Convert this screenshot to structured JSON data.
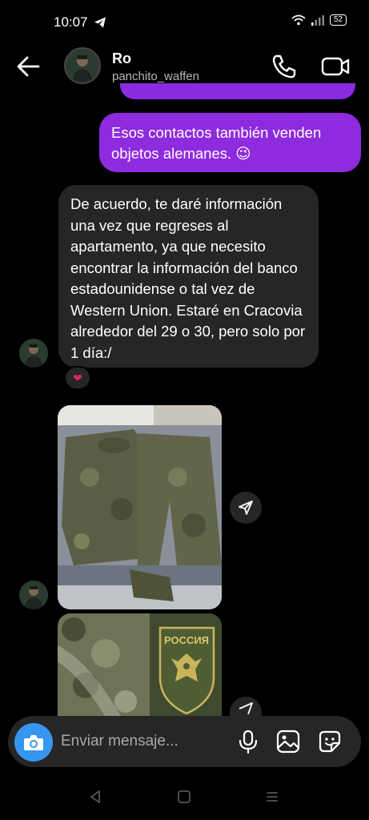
{
  "status_bar": {
    "time": "10:07",
    "battery": "52"
  },
  "header": {
    "name": "Ro",
    "username": "panchito_waffen"
  },
  "messages": [
    {
      "direction": "outgoing",
      "text": "Esos contactos también venden objetos alemanes. 😉"
    },
    {
      "direction": "incoming",
      "text": "De acuerdo, te daré información una vez que regreses al apartamento, ya que necesito encontrar la información del banco estadounidense o tal vez de Western Union. Estaré en Cracovia alrededor del 29 o 30, pero solo por 1 día:/",
      "reaction": "❤"
    },
    {
      "direction": "incoming",
      "type": "photo",
      "subject": "camouflage-uniform"
    },
    {
      "direction": "incoming",
      "type": "photo",
      "subject": "russia-patch",
      "patch_text": "РОССИЯ"
    }
  ],
  "composer": {
    "placeholder": "Enviar mensaje..."
  },
  "colors": {
    "outgoing_bubble": "#8e2bdf",
    "incoming_bubble": "#262626",
    "camera_button": "#3797f0",
    "background": "#000000"
  },
  "icons": [
    "back-arrow-icon",
    "phone-icon",
    "video-icon",
    "camera-icon",
    "microphone-icon",
    "gallery-icon",
    "sticker-icon",
    "share-icon",
    "heart-icon"
  ]
}
